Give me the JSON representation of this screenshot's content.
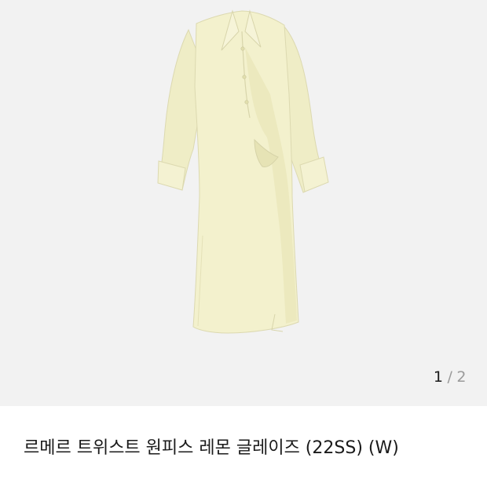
{
  "gallery": {
    "image_alt": "르메르 트위스트 원피스 레몬 글레이즈",
    "current_page": "1",
    "separator": "/",
    "total_pages": "2"
  },
  "product": {
    "title": "르메르 트위스트 원피스 레몬 글레이즈 (22SS) (W)"
  },
  "colors": {
    "photo_background": "#f2f2f2",
    "garment": "#f3f1cd",
    "text": "#1a1a1a",
    "pager_muted": "#9a9a9a"
  }
}
